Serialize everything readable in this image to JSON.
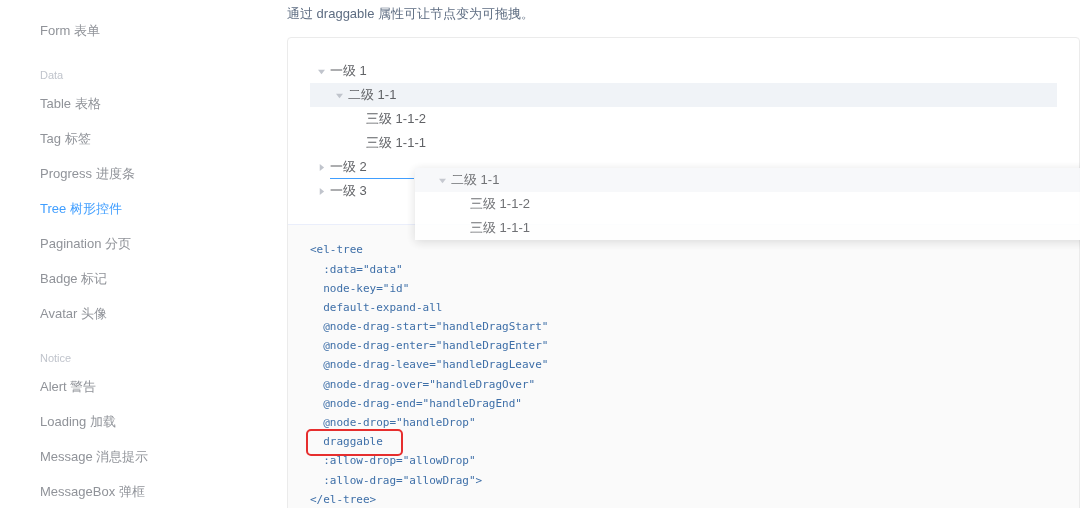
{
  "sidebar": {
    "groups": [
      {
        "items": [
          {
            "label": "Form 表单",
            "selected": false
          }
        ]
      },
      {
        "title": "Data",
        "items": [
          {
            "label": "Table 表格",
            "selected": false
          },
          {
            "label": "Tag 标签",
            "selected": false
          },
          {
            "label": "Progress 进度条",
            "selected": false
          },
          {
            "label": "Tree 树形控件",
            "selected": true
          },
          {
            "label": "Pagination 分页",
            "selected": false
          },
          {
            "label": "Badge 标记",
            "selected": false
          },
          {
            "label": "Avatar 头像",
            "selected": false
          }
        ]
      },
      {
        "title": "Notice",
        "items": [
          {
            "label": "Alert 警告",
            "selected": false
          },
          {
            "label": "Loading 加载",
            "selected": false
          },
          {
            "label": "Message 消息提示",
            "selected": false
          },
          {
            "label": "MessageBox 弹框",
            "selected": false
          }
        ]
      }
    ]
  },
  "description": "通过 draggable 属性可让节点变为可拖拽。",
  "tree": [
    {
      "label": "一级 1",
      "expanded": true,
      "highlighted": false,
      "drop_line": false,
      "children": [
        {
          "label": "二级 1-1",
          "expanded": true,
          "highlighted": true,
          "drop_line": false,
          "children": [
            {
              "label": "三级 1-1-2",
              "highlighted": false,
              "drop_line": false
            },
            {
              "label": "三级 1-1-1",
              "highlighted": false,
              "drop_line": false
            }
          ]
        }
      ]
    },
    {
      "label": "一级 2",
      "expanded": false,
      "highlighted": false,
      "drop_line": true
    },
    {
      "label": "一级 3",
      "expanded": false,
      "highlighted": false,
      "drop_line": false
    }
  ],
  "drag_ghost": {
    "label": "二级 1-1",
    "expanded": true,
    "children": [
      {
        "label": "三级 1-1-2"
      },
      {
        "label": "三级 1-1-1"
      }
    ]
  },
  "code": [
    {
      "text": "<el-tree",
      "highlighted": false
    },
    {
      "text": "  :data=\"data\"",
      "highlighted": false
    },
    {
      "text": "  node-key=\"id\"",
      "highlighted": false
    },
    {
      "text": "  default-expand-all",
      "highlighted": false
    },
    {
      "text": "  @node-drag-start=\"handleDragStart\"",
      "highlighted": false
    },
    {
      "text": "  @node-drag-enter=\"handleDragEnter\"",
      "highlighted": false
    },
    {
      "text": "  @node-drag-leave=\"handleDragLeave\"",
      "highlighted": false
    },
    {
      "text": "  @node-drag-over=\"handleDragOver\"",
      "highlighted": false
    },
    {
      "text": "  @node-drag-end=\"handleDragEnd\"",
      "highlighted": false
    },
    {
      "text": "  @node-drop=\"handleDrop\"",
      "highlighted": false
    },
    {
      "text": "  draggable",
      "highlighted": true
    },
    {
      "text": "  :allow-drop=\"allowDrop\"",
      "highlighted": false
    },
    {
      "text": "  :allow-drag=\"allowDrag\">",
      "highlighted": false
    },
    {
      "text": "</el-tree>",
      "highlighted": false
    }
  ]
}
